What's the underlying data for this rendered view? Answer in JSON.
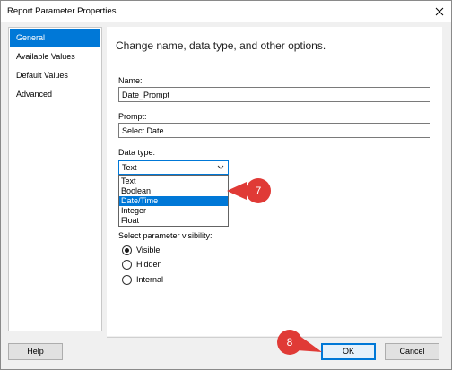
{
  "window": {
    "title": "Report Parameter Properties"
  },
  "nav": {
    "items": [
      {
        "label": "General",
        "active": true
      },
      {
        "label": "Available Values",
        "active": false
      },
      {
        "label": "Default Values",
        "active": false
      },
      {
        "label": "Advanced",
        "active": false
      }
    ]
  },
  "general": {
    "heading": "Change name, data type, and other options.",
    "name_label": "Name:",
    "name_value": "Date_Prompt",
    "prompt_label": "Prompt:",
    "prompt_value": "Select Date",
    "datatype_label": "Data type:",
    "datatype_value": "Text",
    "datatype_options": [
      "Text",
      "Boolean",
      "Date/Time",
      "Integer",
      "Float"
    ],
    "datatype_highlighted": "Date/Time",
    "visibility_label": "Select parameter visibility:",
    "visibility_options": [
      {
        "label": "Visible",
        "checked": true
      },
      {
        "label": "Hidden",
        "checked": false
      },
      {
        "label": "Internal",
        "checked": false
      }
    ]
  },
  "buttons": {
    "help": "Help",
    "ok": "OK",
    "cancel": "Cancel"
  },
  "callouts": {
    "step7": "7",
    "step8": "8"
  },
  "colors": {
    "accent": "#0078d7",
    "callout": "#e03a36"
  }
}
